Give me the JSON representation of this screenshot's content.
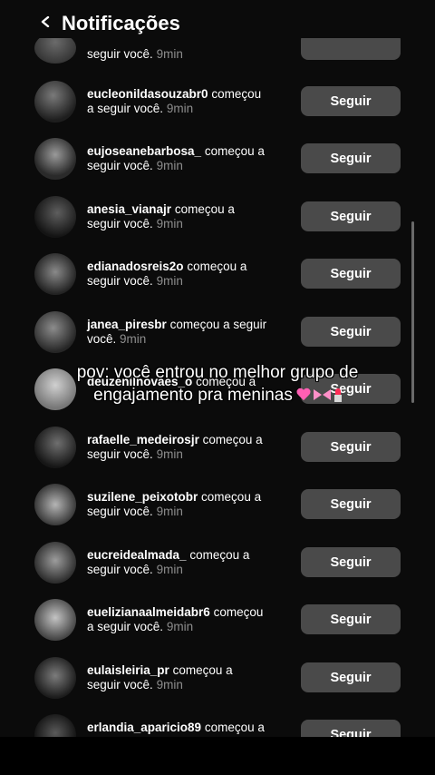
{
  "header": {
    "title": "Notificações"
  },
  "overlay_caption": {
    "line1": "pov: você entrou no melhor grupo de",
    "line2": "engajamento pra meninas"
  },
  "top_partial_row": {
    "text": "seguir você.",
    "time": "9min",
    "button": ""
  },
  "notifications": [
    {
      "username": "eucleonildasouzabr0",
      "action": "começou",
      "action2": "a seguir você.",
      "time": "9min",
      "button": "Seguir"
    },
    {
      "username": "eujoseanebarbosa_",
      "action": "começou a",
      "action2": "seguir você.",
      "time": "9min",
      "button": "Seguir"
    },
    {
      "username": "anesia_vianajr",
      "action": "começou a",
      "action2": "seguir você.",
      "time": "9min",
      "button": "Seguir"
    },
    {
      "username": "edianadosreis2o",
      "action": "começou a",
      "action2": "seguir você.",
      "time": "9min",
      "button": "Seguir"
    },
    {
      "username": "janea_piresbr",
      "action": "começou a seguir",
      "action2": "você.",
      "time": "9min",
      "button": "Seguir"
    },
    {
      "username": "deuzenilnovaes_o",
      "action": "começou a",
      "action2": "",
      "time": "",
      "button": "Seguir"
    },
    {
      "username": "rafaelle_medeirosjr",
      "action": "começou a",
      "action2": "seguir você.",
      "time": "9min",
      "button": "Seguir"
    },
    {
      "username": "suzilene_peixotobr",
      "action": "começou a",
      "action2": "seguir você.",
      "time": "9min",
      "button": "Seguir"
    },
    {
      "username": "eucreidealmada_",
      "action": "começou a",
      "action2": "seguir você.",
      "time": "9min",
      "button": "Seguir"
    },
    {
      "username": "euelizianaalmeidabr6",
      "action": "começou",
      "action2": "a seguir você.",
      "time": "9min",
      "button": "Seguir"
    },
    {
      "username": "eulaisleiria_pr",
      "action": "começou a",
      "action2": "seguir você.",
      "time": "9min",
      "button": "Seguir"
    },
    {
      "username": "erlandia_aparicio89",
      "action": "começou a",
      "action2": "",
      "time": "",
      "button": "Seguir"
    }
  ],
  "colors": {
    "background": "#0b0b0b",
    "button": "#4a4a4a",
    "time_text": "#8e8e8e",
    "text": "#ffffff"
  }
}
